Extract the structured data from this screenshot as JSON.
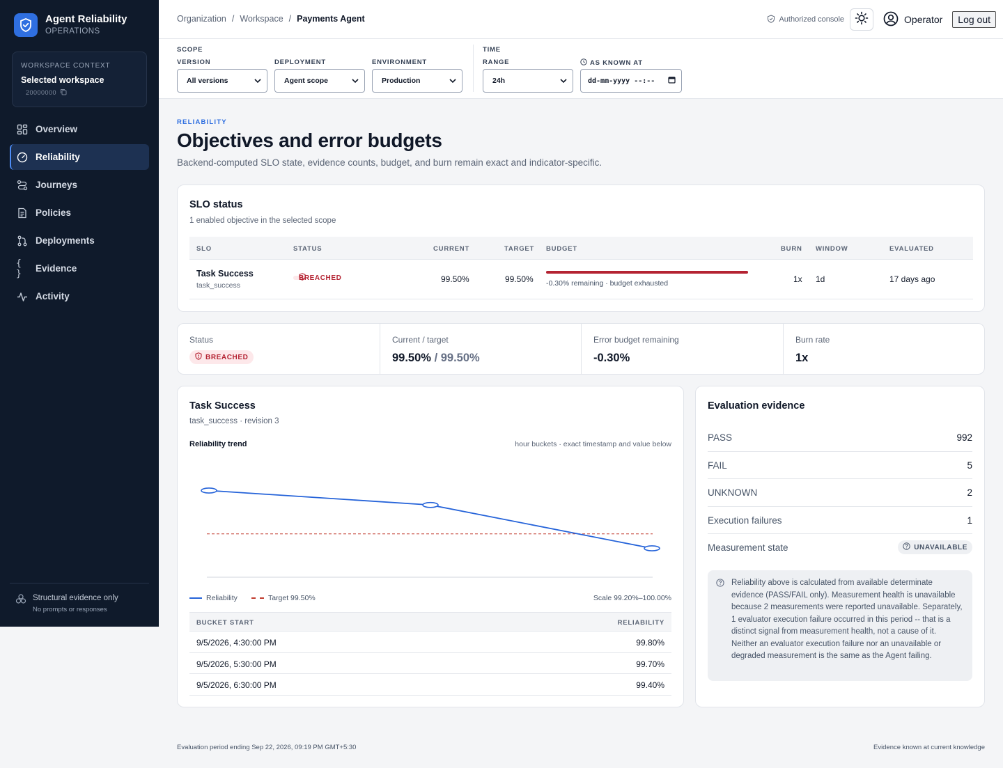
{
  "sidebar": {
    "brand_title": "Agent Reliability",
    "brand_subtitle": "OPERATIONS",
    "workspace_label": "WORKSPACE CONTEXT",
    "workspace_name": "Selected workspace",
    "workspace_id": "20000000",
    "nav": [
      {
        "label": "Overview",
        "icon": "grid-icon"
      },
      {
        "label": "Reliability",
        "icon": "gauge-icon",
        "active": true
      },
      {
        "label": "Journeys",
        "icon": "route-icon"
      },
      {
        "label": "Policies",
        "icon": "document-icon"
      },
      {
        "label": "Deployments",
        "icon": "git-branch-icon"
      },
      {
        "label": "Evidence",
        "icon": "braces-icon"
      },
      {
        "label": "Activity",
        "icon": "pulse-icon"
      }
    ],
    "footer_title": "Structural evidence only",
    "footer_sub": "No prompts or responses"
  },
  "topbar": {
    "crumbs": [
      "Organization",
      "/",
      "Workspace",
      "/",
      "Payments Agent"
    ],
    "authorized": "Authorized console",
    "operator": "Operator",
    "logout": "Log out"
  },
  "filters": {
    "scope_label": "SCOPE",
    "time_label": "TIME",
    "version_label": "VERSION",
    "version_value": "All versions",
    "deployment_label": "DEPLOYMENT",
    "deployment_value": "Agent scope",
    "environment_label": "ENVIRONMENT",
    "environment_value": "Production",
    "range_label": "RANGE",
    "range_value": "24h",
    "known_label": "AS KNOWN AT",
    "known_value": "dd-mm-yyyy --:--"
  },
  "page": {
    "eyebrow": "RELIABILITY",
    "title": "Objectives and error budgets",
    "subtitle": "Backend-computed SLO state, evidence counts, budget, and burn remain exact and indicator-specific."
  },
  "slo_status": {
    "title": "SLO status",
    "subtitle": "1 enabled objective in the selected scope",
    "headers": [
      "SLO",
      "STATUS",
      "CURRENT",
      "TARGET",
      "BUDGET",
      "BURN",
      "WINDOW",
      "EVALUATED"
    ],
    "row": {
      "name": "Task Success",
      "key": "task_success",
      "status": "BREACHED",
      "current": "99.50%",
      "target": "99.50%",
      "budget_fill": 1.0,
      "budget_text": "-0.30% remaining · budget exhausted",
      "burn": "1x",
      "window": "1d",
      "evaluated": "17 days ago"
    }
  },
  "stats": {
    "status_label": "Status",
    "status_value": "BREACHED",
    "ct_label": "Current / target",
    "ct_current": "99.50%",
    "ct_target": "/ 99.50%",
    "budget_label": "Error budget remaining",
    "budget_value": "-0.30%",
    "burn_label": "Burn rate",
    "burn_value": "1x"
  },
  "trend": {
    "title": "Task Success",
    "subtitle": "task_success · revision 3",
    "chart_title": "Reliability trend",
    "chart_note": "hour buckets · exact timestamp and value below",
    "legend_series": "Reliability",
    "legend_target": "Target 99.50%",
    "scale": "Scale 99.20%–100.00%",
    "table_headers": [
      "BUCKET START",
      "RELIABILITY"
    ],
    "rows": [
      {
        "bucket": "9/5/2026, 4:30:00 PM",
        "value": "99.80%"
      },
      {
        "bucket": "9/5/2026, 5:30:00 PM",
        "value": "99.70%"
      },
      {
        "bucket": "9/5/2026, 6:30:00 PM",
        "value": "99.40%"
      }
    ]
  },
  "chart_data": {
    "type": "line",
    "x": [
      "9/5/2026, 4:30:00 PM",
      "9/5/2026, 5:30:00 PM",
      "9/5/2026, 6:30:00 PM"
    ],
    "series": [
      {
        "name": "Reliability",
        "values": [
          99.8,
          99.7,
          99.4
        ],
        "color": "#2563d9"
      }
    ],
    "target": 99.5,
    "ylim": [
      99.2,
      100.0
    ],
    "colors": {
      "series": "#2563d9",
      "target": "#c0392b"
    }
  },
  "evidence": {
    "title": "Evaluation evidence",
    "rows": [
      {
        "k": "PASS",
        "v": "992"
      },
      {
        "k": "FAIL",
        "v": "5"
      },
      {
        "k": "UNKNOWN",
        "v": "2"
      },
      {
        "k": "Execution failures",
        "v": "1"
      }
    ],
    "measurement_label": "Measurement state",
    "measurement_value": "UNAVAILABLE",
    "note": "Reliability above is calculated from available determinate evidence (PASS/FAIL only). Measurement health is unavailable because 2 measurements were reported unavailable. Separately, 1 evaluator execution failure occurred in this period -- that is a distinct signal from measurement health, not a cause of it. Neither an evaluator execution failure nor an unavailable or degraded measurement is the same as the Agent failing."
  },
  "footer": {
    "left": "Evaluation period ending Sep 22, 2026, 09:19 PM GMT+5:30",
    "right": "Evidence known at current knowledge"
  },
  "colors": {
    "accent": "#2f6fe0",
    "sidebar": "#0f1a2b",
    "danger": "#b42332"
  }
}
